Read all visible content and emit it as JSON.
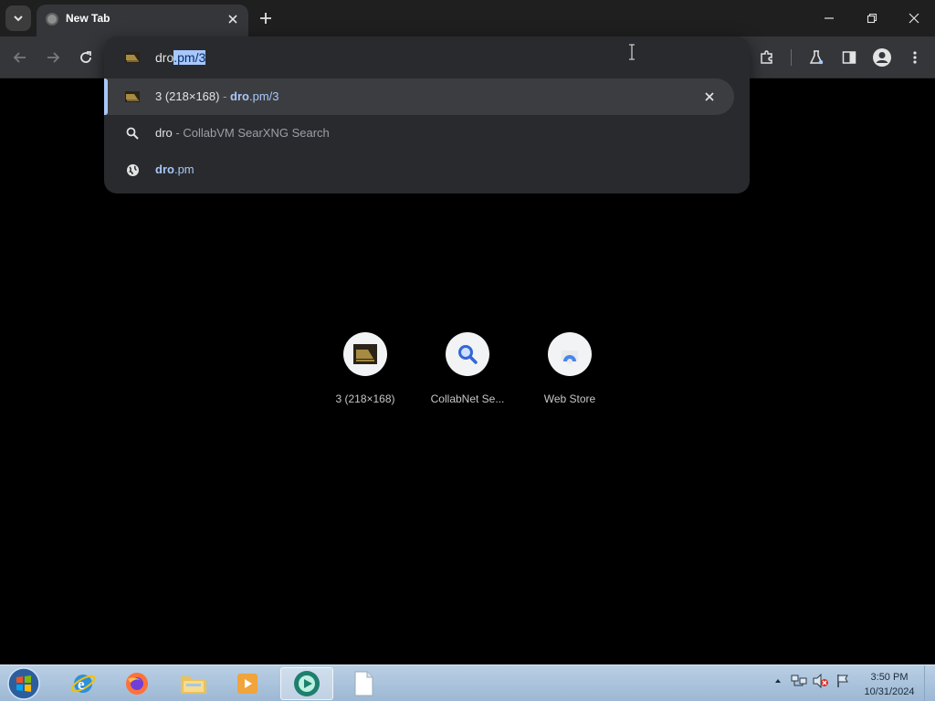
{
  "window": {
    "tab_title": "New Tab"
  },
  "omnibox": {
    "typed": "dro",
    "autocomplete": ".pm/3"
  },
  "suggestions": [
    {
      "title": "3 (218×168)",
      "sep": " - ",
      "url_bold": "dro",
      "url_rest": ".pm/3"
    },
    {
      "title": "dro",
      "sep": " - ",
      "desc": "CollabVM SearXNG Search"
    },
    {
      "url_bold": "dro",
      "url_rest": ".pm"
    }
  ],
  "shortcuts": [
    {
      "label": "3 (218×168)",
      "icon": "image-thumb-icon"
    },
    {
      "label": "CollabNet Se...",
      "icon": "search-icon"
    },
    {
      "label": "Web Store",
      "icon": "web-store-icon"
    }
  ],
  "taskbar": {
    "time": "3:50 PM",
    "date": "10/31/2024"
  },
  "colors": {
    "accent": "#a8c7fa",
    "tab_bg": "#35363a",
    "popup_bg": "#282a2d"
  }
}
